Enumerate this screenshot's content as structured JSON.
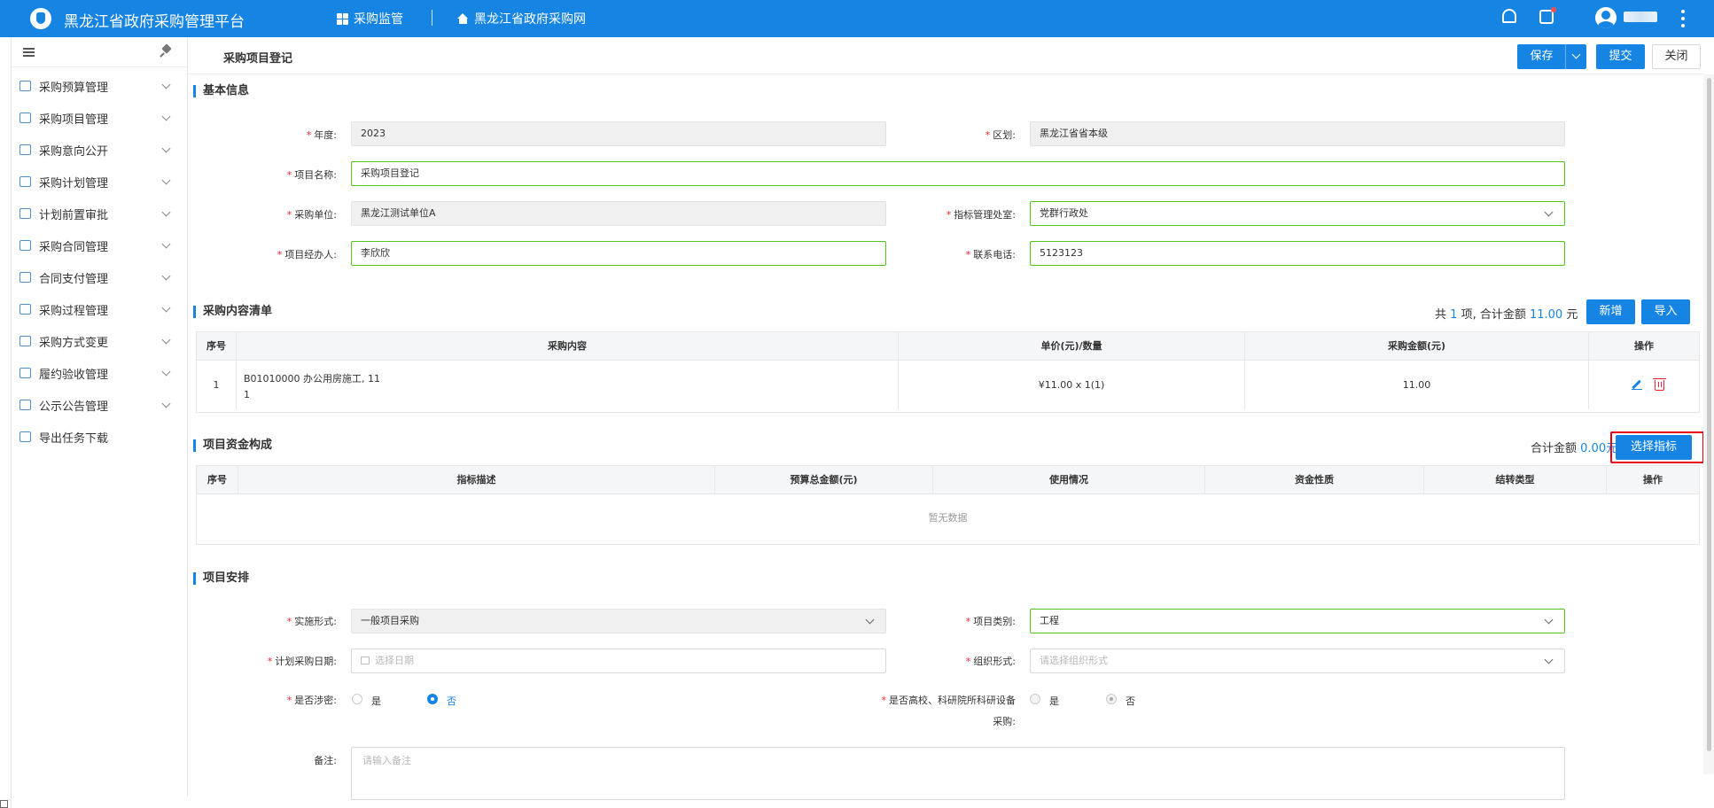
{
  "header": {
    "app_title": "黑龙江省政府采购管理平台",
    "nav": [
      {
        "label": "采购监管",
        "icon": "grid-icon"
      },
      {
        "label": "黑龙江省政府采购网",
        "icon": "home-icon"
      }
    ],
    "icons": [
      "bell-icon",
      "task-icon",
      "user-avatar-icon",
      "more-vertical-icon"
    ]
  },
  "sidebar": {
    "items": [
      {
        "label": "采购预算管理"
      },
      {
        "label": "采购项目管理"
      },
      {
        "label": "采购意向公开"
      },
      {
        "label": "采购计划管理"
      },
      {
        "label": "计划前置审批"
      },
      {
        "label": "采购合同管理"
      },
      {
        "label": "合同支付管理"
      },
      {
        "label": "采购过程管理"
      },
      {
        "label": "采购方式变更"
      },
      {
        "label": "履约验收管理"
      },
      {
        "label": "公示公告管理"
      },
      {
        "label": "导出任务下载"
      }
    ]
  },
  "page": {
    "title": "采购项目登记",
    "actions": {
      "save": "保存",
      "submit": "提交",
      "close": "关闭"
    }
  },
  "basic_info": {
    "title": "基本信息",
    "year_label": "年度:",
    "year_value": "2023",
    "region_label": "区划:",
    "region_value": "黑龙江省省本级",
    "project_name_label": "项目名称:",
    "project_name_value": "采购项目登记",
    "unit_label": "采购单位:",
    "unit_value": "黑龙江测试单位A",
    "office_label": "指标管理处室:",
    "office_value": "党群行政处",
    "manager_label": "项目经办人:",
    "manager_value": "李欣欣",
    "phone_label": "联系电话:",
    "phone_value": "5123123"
  },
  "content_list": {
    "title": "采购内容清单",
    "summary_prefix": "共",
    "count": "1",
    "summary_mid": "项,  合计金额",
    "total": "11.00",
    "summary_suffix": "元",
    "add_button": "新增",
    "import_button": "导入",
    "headers": [
      "序号",
      "采购内容",
      "单价(元)/数量",
      "采购金额(元)",
      "操作"
    ],
    "rows": [
      {
        "index": "1",
        "content_line1": "B01010000 办公用房施工, 11",
        "content_line2": "1",
        "price_qty": "¥11.00 x 1(1)",
        "amount": "11.00"
      }
    ]
  },
  "funding": {
    "title": "项目资金构成",
    "summary_prefix": "合计金额",
    "total": "0.00",
    "summary_suffix": "元",
    "select_button": "选择指标",
    "headers": [
      "序号",
      "指标描述",
      "预算总金额(元)",
      "使用情况",
      "资金性质",
      "结转类型",
      "操作"
    ],
    "empty_text": "暂无数据"
  },
  "arrangement": {
    "title": "项目安排",
    "impl_label": "实施形式:",
    "impl_value": "一般项目采购",
    "category_label": "项目类别:",
    "category_value": "工程",
    "date_label": "计划采购日期:",
    "date_placeholder": "选择日期",
    "org_label": "组织形式:",
    "org_placeholder": "请选择组织形式",
    "secret_label": "是否涉密:",
    "secret_yes": "是",
    "secret_no": "否",
    "univ_label_line1": "是否高校、科研院所科研设备",
    "univ_label_line2": "采购:",
    "univ_yes": "是",
    "univ_no": "否",
    "remark_label": "备注:",
    "remark_placeholder": "请输入备注"
  },
  "colors": {
    "primary": "#1684e3",
    "required": "#f5222d",
    "valid_border": "#52c41a",
    "highlight": "#e60012"
  }
}
